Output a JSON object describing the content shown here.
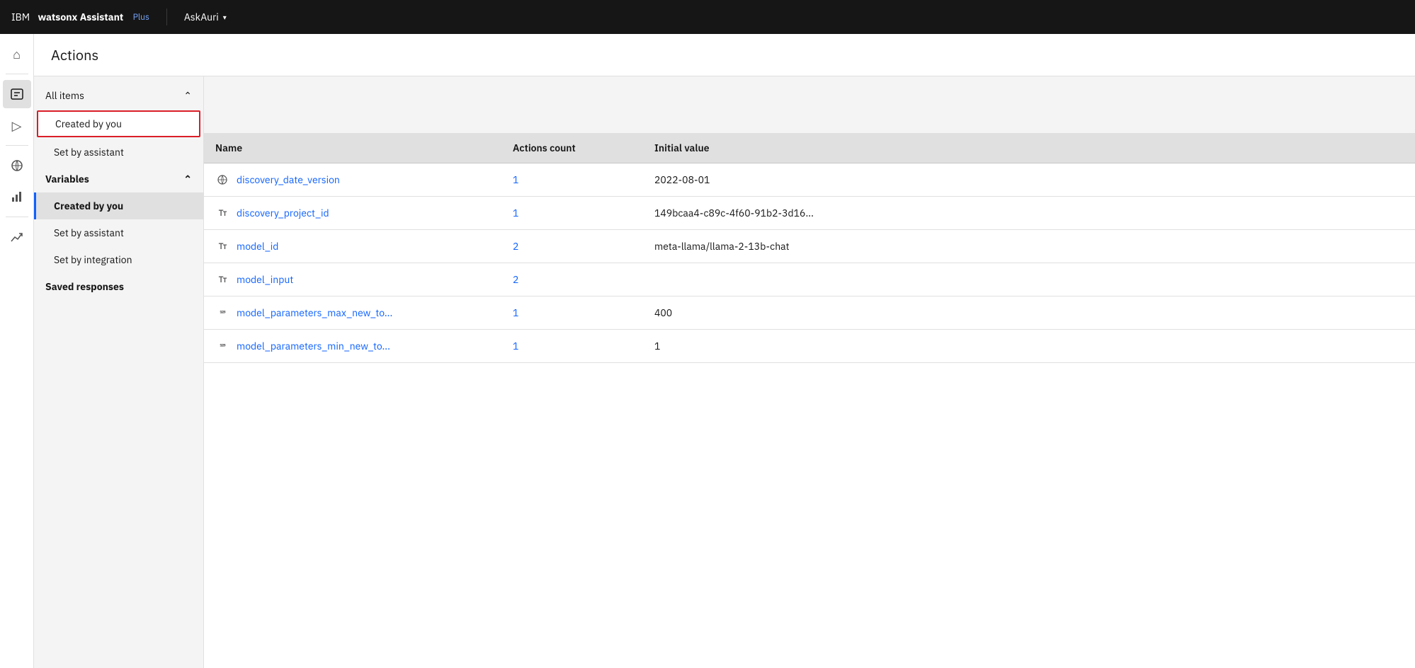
{
  "topbar": {
    "brand_ibm": "IBM",
    "brand_product": "watsonx Assistant",
    "brand_tier": "Plus",
    "workspace_name": "AskAuri",
    "chevron": "▾"
  },
  "page": {
    "title": "Actions"
  },
  "sidebar": {
    "sections": [
      {
        "id": "all-items",
        "label": "All items",
        "expanded": true,
        "bold": false,
        "items": [
          {
            "id": "created-by-you-top",
            "label": "Created by you",
            "active": false,
            "selected_red": true
          },
          {
            "id": "set-by-assistant-top",
            "label": "Set by assistant",
            "active": false
          }
        ]
      },
      {
        "id": "variables",
        "label": "Variables",
        "expanded": true,
        "bold": true,
        "items": [
          {
            "id": "created-by-you",
            "label": "Created by you",
            "active": true,
            "selected_red": false
          },
          {
            "id": "set-by-assistant",
            "label": "Set by assistant",
            "active": false
          },
          {
            "id": "set-by-integration",
            "label": "Set by integration",
            "active": false
          }
        ]
      },
      {
        "id": "saved-responses",
        "label": "Saved responses",
        "expanded": false,
        "bold": true,
        "items": []
      }
    ]
  },
  "table": {
    "columns": [
      {
        "id": "name",
        "label": "Name"
      },
      {
        "id": "actions_count",
        "label": "Actions count"
      },
      {
        "id": "initial_value",
        "label": "Initial value"
      }
    ],
    "rows": [
      {
        "id": "row-1",
        "icon": "globe",
        "icon_display": "⊕",
        "name": "discovery_date_version",
        "actions_count": "1",
        "initial_value": "2022-08-01"
      },
      {
        "id": "row-2",
        "icon": "text",
        "icon_display": "Tт",
        "name": "discovery_project_id",
        "actions_count": "1",
        "initial_value": "149bcaa4-c89c-4f60-91b2-3d16..."
      },
      {
        "id": "row-3",
        "icon": "text",
        "icon_display": "Tт",
        "name": "model_id",
        "actions_count": "2",
        "initial_value": "meta-llama/llama-2-13b-chat"
      },
      {
        "id": "row-4",
        "icon": "text",
        "icon_display": "Tт",
        "name": "model_input",
        "actions_count": "2",
        "initial_value": ""
      },
      {
        "id": "row-5",
        "icon": "number",
        "icon_display": "¹²³",
        "name": "model_parameters_max_new_to...",
        "actions_count": "1",
        "initial_value": "400"
      },
      {
        "id": "row-6",
        "icon": "number",
        "icon_display": "¹²³",
        "name": "model_parameters_min_new_to...",
        "actions_count": "1",
        "initial_value": "1"
      }
    ]
  },
  "icons": {
    "home": "⌂",
    "actions": "💬",
    "trigger": "▷",
    "integrations": "✈",
    "analytics": "📊",
    "divider1": "",
    "growth": "📈"
  }
}
